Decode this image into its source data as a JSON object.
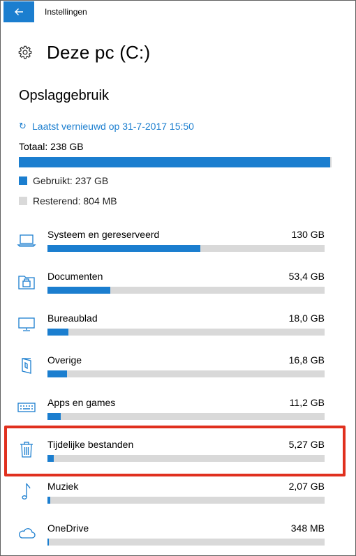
{
  "window": {
    "title": "Instellingen"
  },
  "page": {
    "title": "Deze pc (C:)"
  },
  "storage": {
    "section_title": "Opslaggebruik",
    "refresh_text": "Laatst vernieuwd op 31-7-2017 15:50",
    "total_text": "Totaal: 238 GB",
    "used_fraction": 0.996,
    "used_text": "Gebruikt: 237 GB",
    "free_text": "Resterend: 804 MB"
  },
  "colors": {
    "accent": "#1b7ecf",
    "bar_track": "#d9d9d9",
    "highlight": "#e0301e"
  },
  "categories": [
    {
      "name": "Systeem en gereserveerd",
      "size": "130 GB",
      "fraction": 0.551,
      "icon": "laptop-icon"
    },
    {
      "name": "Documenten",
      "size": "53,4 GB",
      "fraction": 0.226,
      "icon": "documents-folder-icon"
    },
    {
      "name": "Bureaublad",
      "size": "18,0 GB",
      "fraction": 0.076,
      "icon": "monitor-icon"
    },
    {
      "name": "Overige",
      "size": "16,8 GB",
      "fraction": 0.071,
      "icon": "other-folder-icon"
    },
    {
      "name": "Apps en games",
      "size": "11,2 GB",
      "fraction": 0.047,
      "icon": "keyboard-icon"
    },
    {
      "name": "Tijdelijke bestanden",
      "size": "5,27 GB",
      "fraction": 0.022,
      "icon": "trash-icon"
    },
    {
      "name": "Muziek",
      "size": "2,07 GB",
      "fraction": 0.009,
      "icon": "music-note-icon"
    },
    {
      "name": "OneDrive",
      "size": "348 MB",
      "fraction": 0.0015,
      "icon": "cloud-icon"
    }
  ]
}
